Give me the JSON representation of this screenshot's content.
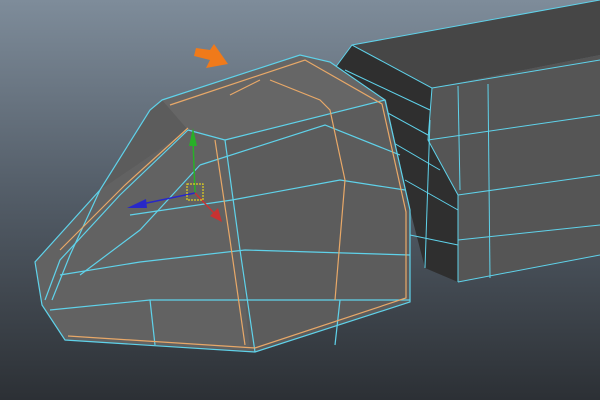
{
  "viewport": {
    "colors": {
      "wire": "#5fd2ea",
      "selected_edges": "#e8a868",
      "annotation_arrow": "#f07a1a",
      "axis_x": "#c83232",
      "axis_y": "#28b028",
      "axis_z": "#2828c8",
      "pivot": "#e0d020"
    }
  }
}
